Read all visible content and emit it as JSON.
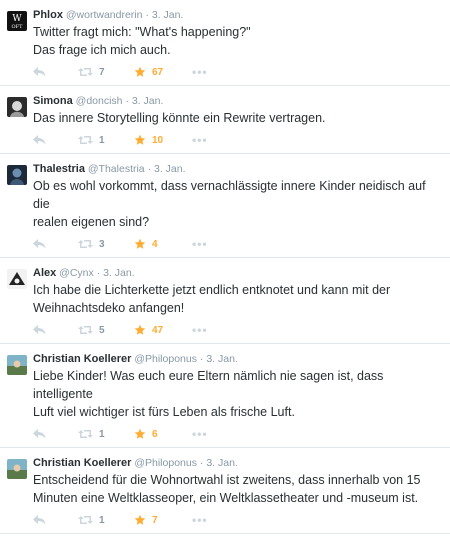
{
  "tweets": [
    {
      "fullname": "Phlox",
      "username": "@wortwandrerin",
      "time": "3. Jan.",
      "text": [
        "Twitter fragt mich: \"What's happening?\"",
        "Das frage ich mich auch."
      ],
      "retweets": "7",
      "favorites": "67"
    },
    {
      "fullname": "Simona",
      "username": "@doncish",
      "time": "3. Jan.",
      "text": [
        "Das innere Storytelling könnte ein Rewrite vertragen."
      ],
      "retweets": "1",
      "favorites": "10"
    },
    {
      "fullname": "Thalestria",
      "username": "@Thalestria",
      "time": "3. Jan.",
      "text": [
        "Ob es wohl vorkommt, dass vernachlässigte innere Kinder neidisch auf die",
        "realen eigenen sind?"
      ],
      "retweets": "3",
      "favorites": "4"
    },
    {
      "fullname": "Alex",
      "username": "@Cynx",
      "time": "3. Jan.",
      "text": [
        "Ich habe die Lichterkette jetzt endlich entknotet und kann mit der",
        "Weihnachtsdeko anfangen!"
      ],
      "retweets": "5",
      "favorites": "47"
    },
    {
      "fullname": "Christian Koellerer",
      "username": "@Philoponus",
      "time": "3. Jan.",
      "text": [
        "Liebe Kinder! Was euch eure Eltern nämlich nie sagen ist, dass intelligente",
        "Luft viel wichtiger ist fürs Leben als frische Luft."
      ],
      "retweets": "1",
      "favorites": "6"
    },
    {
      "fullname": "Christian Koellerer",
      "username": "@Philoponus",
      "time": "3. Jan.",
      "text": [
        "Entscheidend für die Wohnortwahl ist zweitens, dass innerhalb von 15",
        "Minuten eine Weltklasseoper, ein Weltklassetheater und -museum ist."
      ],
      "retweets": "1",
      "favorites": "7"
    }
  ],
  "separator": "·",
  "more_label": "•••",
  "colors": {
    "favorite": "#ffac33",
    "muted": "#8899a6",
    "icon": "#ccd6dd",
    "text": "#292f33"
  },
  "icons": {
    "reply": "reply-icon",
    "retweet": "retweet-icon",
    "favorite": "star-icon",
    "more": "more-icon"
  }
}
